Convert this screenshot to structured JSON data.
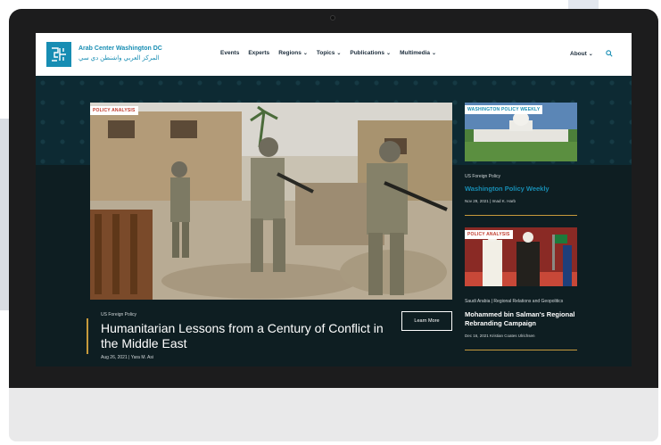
{
  "brand": {
    "name_en": "Arab Center Washington DC",
    "name_ar": "المركز العربي واشنطن دي سي"
  },
  "nav": {
    "items": [
      {
        "label": "Events",
        "dropdown": false
      },
      {
        "label": "Experts",
        "dropdown": false
      },
      {
        "label": "Regions",
        "dropdown": true
      },
      {
        "label": "Topics",
        "dropdown": true
      },
      {
        "label": "Publications",
        "dropdown": true
      },
      {
        "label": "Multimedia",
        "dropdown": true
      }
    ],
    "about": "About",
    "chevron": "❯"
  },
  "hero": {
    "tag": "POLICY ANALYSIS",
    "category": "US Foreign Policy",
    "title": "Humanitarian Lessons from a Century of Conflict in the Middle East",
    "meta": "Aug 26, 2021 | Yara M. Asi",
    "cta": "Learn More"
  },
  "side": [
    {
      "tag": "WASHINGTON POLICY WEEKLY",
      "category": "US Foreign Policy",
      "title": "Washington Policy Weekly",
      "meta": "Nov 29, 2021 | Imad K. Harb"
    },
    {
      "tag": "POLICY ANALYSIS",
      "category": "Saudi Arabia | Regional Relations and Geopolitics",
      "title_line1": "Mohammed bin Salman's Regional",
      "title_line2": "Rebranding Campaign",
      "meta": "Dec 16, 2021   Kristian Coates Ulrichsen"
    }
  ],
  "colors": {
    "brand_blue": "#178db3",
    "gold_accent": "#c79a3c",
    "tag_red": "#c0392b",
    "hero_bg": "#0d2a33"
  },
  "icons": {
    "search": "search-icon",
    "logo": "logo-icon"
  }
}
